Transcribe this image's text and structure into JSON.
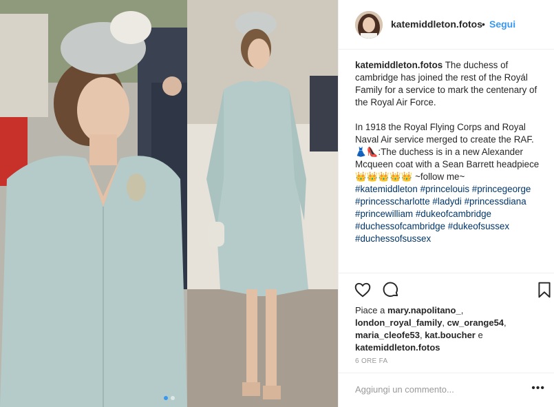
{
  "post": {
    "username": "katemiddleton.fotos",
    "separator": "•",
    "follow_label": "Segui",
    "caption": {
      "line1": "The duchess of cambridge has joined the rest of the Royál Family for a service to mark the centenary of the Royal Air Force.",
      "line2": "In 1918 the Royal Flying Corps and Royal Naval Air service merged to create the RAF.",
      "line3": "👗👠:The duchess is in a new Alexander Mcqueen coat with a Sean Barrett headpiece",
      "line4": "👑👑👑👑👑 ~follow me~",
      "hashtags": [
        "#katemiddleton",
        "#princelouis",
        "#princegeorge",
        "#princesscharlotte",
        "#ladydi",
        "#princessdiana",
        "#princewilliam",
        "#dukeofcambridge",
        "#duchessofcambridge",
        "#dukeofsussex",
        "#duchessofsussex"
      ]
    },
    "likes": {
      "prefix": "Piace a",
      "users": [
        "mary.napolitano_",
        "london_royal_family",
        "cw_orange54",
        "maria_cleofe53",
        "kat.boucher"
      ],
      "conjunction": "e",
      "last_user": "katemiddleton.fotos"
    },
    "time_ago": "6 ORE FA",
    "comment_placeholder": "Aggiungi un commento...",
    "more_icon": "ellipsis-icon",
    "carousel": {
      "count": 2,
      "active_index": 0
    }
  },
  "colors": {
    "accent": "#3897f0",
    "hashtag": "#003569",
    "text": "#262626",
    "muted": "#999999",
    "coat": "#b4cbc9"
  },
  "icons": [
    "heart-icon",
    "comment-icon",
    "bookmark-icon",
    "ellipsis-icon"
  ]
}
